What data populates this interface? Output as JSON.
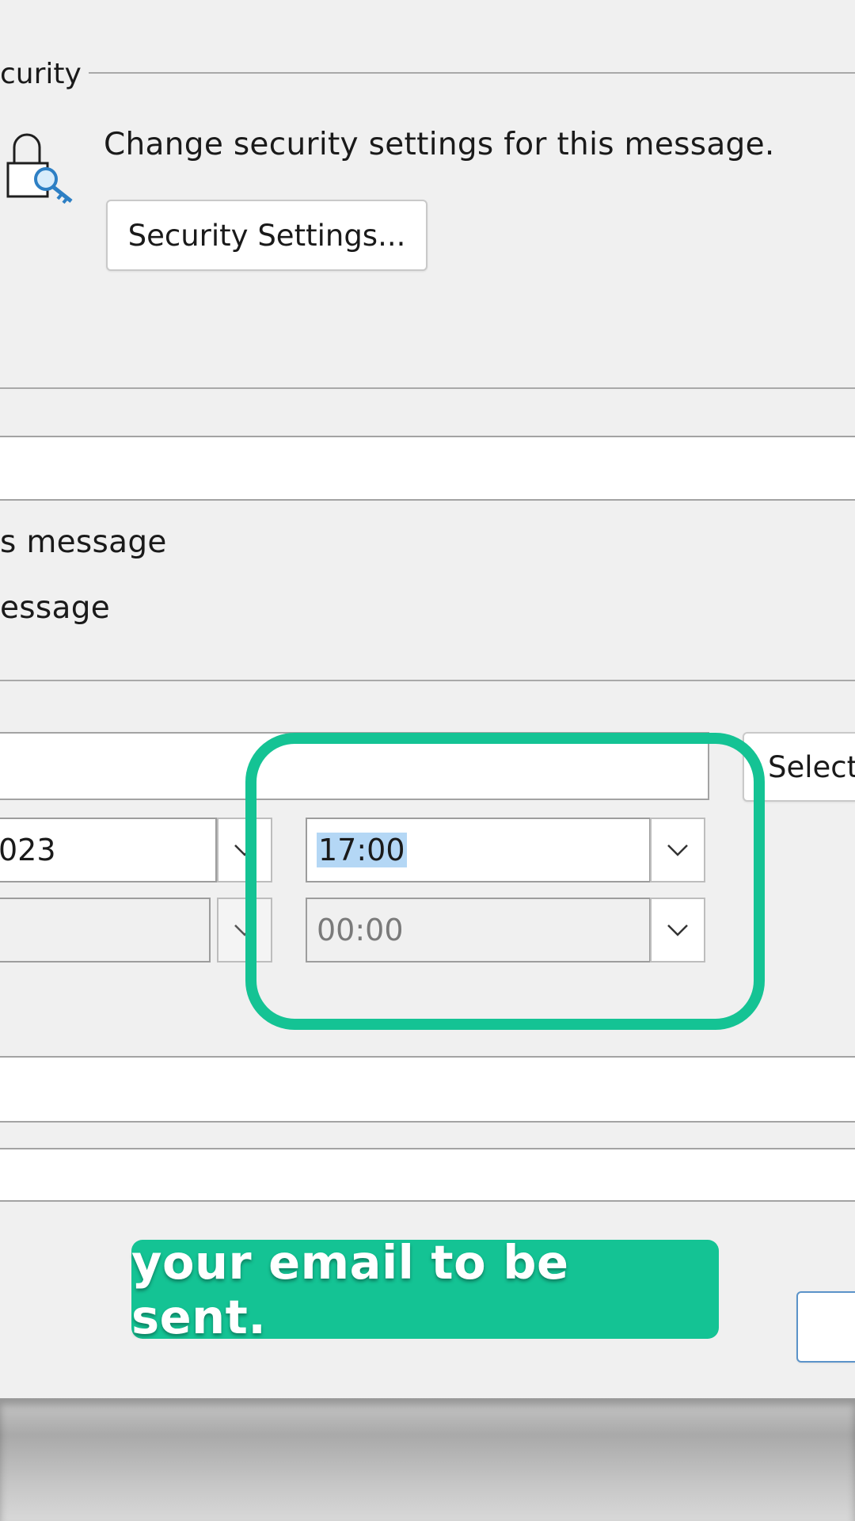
{
  "security": {
    "section_label": "curity",
    "description": "Change security settings for this message.",
    "button_label": "Security Settings...",
    "icon": "lock-key-icon"
  },
  "tracking": {
    "option1": "s message",
    "option2": "essage"
  },
  "delivery": {
    "select_button_label": "Select",
    "do_not_deliver_date": "023",
    "do_not_deliver_time": "17:00",
    "expires_date": "",
    "expires_time": "00:00"
  },
  "caption": {
    "text": "your email to be sent."
  },
  "colors": {
    "highlight": "#14c394",
    "selection": "#b4d7f5"
  }
}
